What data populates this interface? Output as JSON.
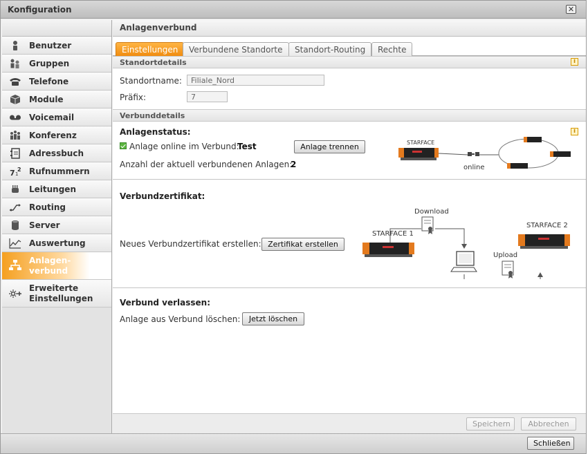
{
  "window": {
    "title": "Konfiguration",
    "close_icon": "close-icon"
  },
  "sidebar": {
    "items": [
      {
        "label": "Benutzer",
        "icon": "user-icon"
      },
      {
        "label": "Gruppen",
        "icon": "group-icon"
      },
      {
        "label": "Telefone",
        "icon": "phone-icon"
      },
      {
        "label": "Module",
        "icon": "module-icon"
      },
      {
        "label": "Voicemail",
        "icon": "voicemail-icon"
      },
      {
        "label": "Konferenz",
        "icon": "conference-icon"
      },
      {
        "label": "Adressbuch",
        "icon": "addressbook-icon"
      },
      {
        "label": "Rufnummern",
        "icon": "numbers-icon"
      },
      {
        "label": "Leitungen",
        "icon": "line-icon"
      },
      {
        "label": "Routing",
        "icon": "routing-icon"
      },
      {
        "label": "Server",
        "icon": "server-icon"
      },
      {
        "label": "Auswertung",
        "icon": "chart-icon"
      },
      {
        "label_line1": "Anlagen-",
        "label_line2": "verbund",
        "icon": "network-icon"
      },
      {
        "label_line1": "Erweiterte",
        "label_line2": "Einstellungen",
        "icon": "advanced-settings-icon"
      }
    ]
  },
  "content": {
    "header": "Anlagenverbund",
    "tabs": [
      "Einstellungen",
      "Verbundene Standorte",
      "Standort-Routing",
      "Rechte"
    ],
    "standortdetails": {
      "section_title": "Standortdetails",
      "name_label": "Standortname:",
      "name_value": "Filiale_Nord",
      "prefix_label": "Präfix:",
      "prefix_value": "7"
    },
    "verbunddetails": {
      "section_title": "Verbunddetails",
      "status_heading": "Anlagenstatus:",
      "online_label": "Anlage online im Verbund:",
      "online_value": "Test",
      "disconnect_button": "Anlage trennen",
      "count_label": "Anzahl der aktuell verbundenen Anlagen:",
      "count_value": "2",
      "diagram_brand": "STARFACE",
      "diagram_online": "online"
    },
    "certificate": {
      "heading": "Verbundzertifikat:",
      "create_label": "Neues Verbundzertifikat erstellen:",
      "create_button": "Zertifikat erstellen",
      "download": "Download",
      "upload": "Upload",
      "starface1": "STARFACE 1",
      "starface2": "STARFACE 2"
    },
    "leave": {
      "heading": "Verbund verlassen:",
      "delete_label": "Anlage aus Verbund löschen:",
      "delete_button": "Jetzt löschen"
    },
    "footer": {
      "save": "Speichern",
      "cancel": "Abbrechen"
    }
  },
  "window_footer": {
    "close": "Schließen"
  },
  "colors": {
    "accent": "#f08c10",
    "active_nav": "#f5a020"
  }
}
